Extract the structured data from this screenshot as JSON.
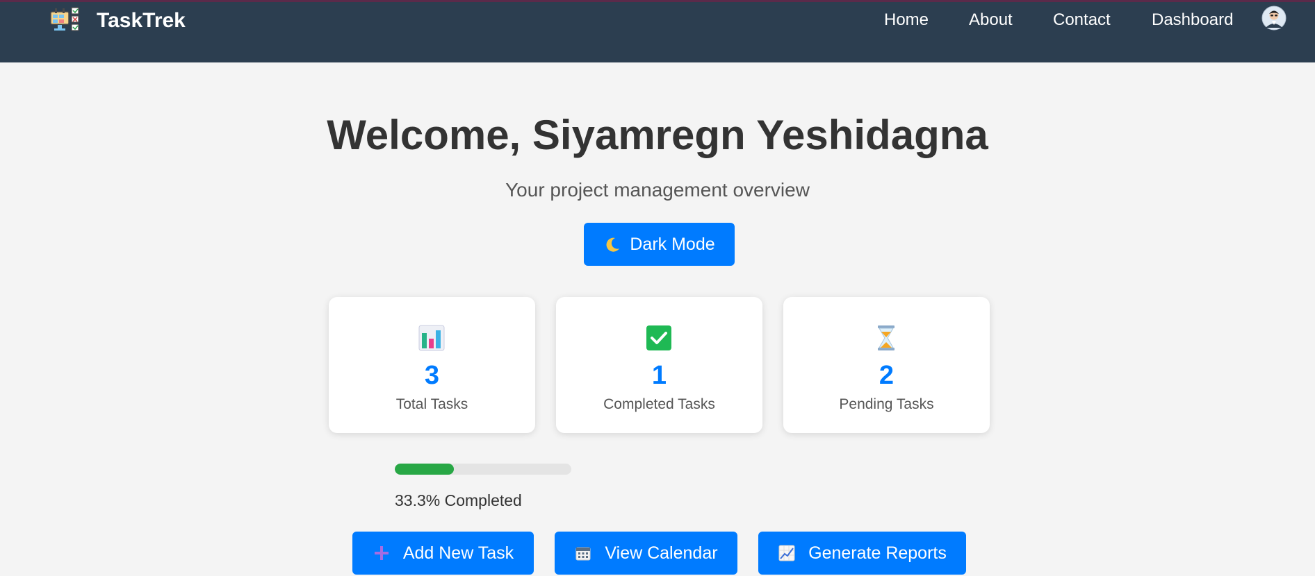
{
  "nav": {
    "brand": "TaskTrek",
    "links": [
      "Home",
      "About",
      "Contact",
      "Dashboard"
    ]
  },
  "welcome": {
    "title": "Welcome, Siyamregn Yeshidagna",
    "subtitle": "Your project management overview"
  },
  "dark_mode": {
    "label": "Dark Mode",
    "icon": "moon-icon"
  },
  "stats": [
    {
      "value": "3",
      "label": "Total Tasks",
      "icon": "bar-chart-icon"
    },
    {
      "value": "1",
      "label": "Completed Tasks",
      "icon": "checkmark-icon"
    },
    {
      "value": "2",
      "label": "Pending Tasks",
      "icon": "hourglass-icon"
    }
  ],
  "progress": {
    "percent": 33.3,
    "label": "33.3% Completed"
  },
  "actions": [
    {
      "label": "Add New Task",
      "icon": "plus-icon"
    },
    {
      "label": "View Calendar",
      "icon": "calendar-icon"
    },
    {
      "label": "Generate Reports",
      "icon": "chart-up-icon"
    }
  ],
  "colors": {
    "navbar": "#2c3e50",
    "accent": "#007bff",
    "progress": "#28a745"
  }
}
